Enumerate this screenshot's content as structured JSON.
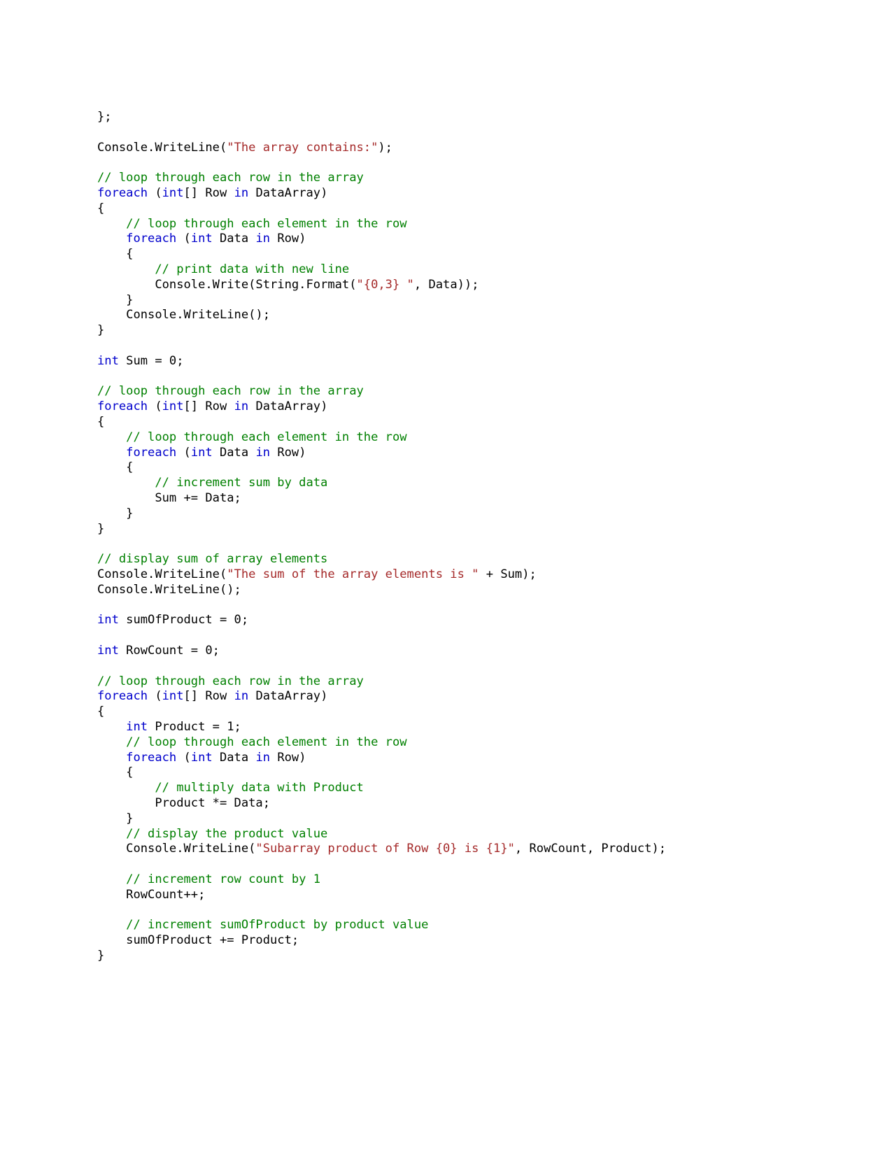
{
  "document": {
    "type": "code-listing",
    "language": "C#",
    "font": "monospace",
    "background_color": "#ffffff"
  },
  "colors": {
    "plain": "#000000",
    "keyword": "#0000CC",
    "comment": "#008000",
    "string": "#A52A2A",
    "background": "#ffffff"
  },
  "code": {
    "lines": [
      {
        "indent": 0,
        "tokens": [
          {
            "t": "};",
            "c": "plain"
          }
        ]
      },
      {
        "indent": 0,
        "tokens": []
      },
      {
        "indent": 0,
        "tokens": [
          {
            "t": "Console.WriteLine(",
            "c": "plain"
          },
          {
            "t": "\"The array contains:\"",
            "c": "string"
          },
          {
            "t": ");",
            "c": "plain"
          }
        ]
      },
      {
        "indent": 0,
        "tokens": []
      },
      {
        "indent": 0,
        "tokens": [
          {
            "t": "// loop through each row in the array",
            "c": "comment"
          }
        ]
      },
      {
        "indent": 0,
        "tokens": [
          {
            "t": "foreach",
            "c": "keyword"
          },
          {
            "t": " (",
            "c": "plain"
          },
          {
            "t": "int",
            "c": "keyword"
          },
          {
            "t": "[] Row ",
            "c": "plain"
          },
          {
            "t": "in",
            "c": "keyword"
          },
          {
            "t": " DataArray)",
            "c": "plain"
          }
        ]
      },
      {
        "indent": 0,
        "tokens": [
          {
            "t": "{",
            "c": "plain"
          }
        ]
      },
      {
        "indent": 1,
        "tokens": [
          {
            "t": "// loop through each element in the row",
            "c": "comment"
          }
        ]
      },
      {
        "indent": 1,
        "tokens": [
          {
            "t": "foreach",
            "c": "keyword"
          },
          {
            "t": " (",
            "c": "plain"
          },
          {
            "t": "int",
            "c": "keyword"
          },
          {
            "t": " Data ",
            "c": "plain"
          },
          {
            "t": "in",
            "c": "keyword"
          },
          {
            "t": " Row)",
            "c": "plain"
          }
        ]
      },
      {
        "indent": 1,
        "tokens": [
          {
            "t": "{",
            "c": "plain"
          }
        ]
      },
      {
        "indent": 2,
        "tokens": [
          {
            "t": "// print data with new line",
            "c": "comment"
          }
        ]
      },
      {
        "indent": 2,
        "tokens": [
          {
            "t": "Console.Write(String.Format(",
            "c": "plain"
          },
          {
            "t": "\"{0,3} \"",
            "c": "string"
          },
          {
            "t": ", Data));",
            "c": "plain"
          }
        ]
      },
      {
        "indent": 1,
        "tokens": [
          {
            "t": "}",
            "c": "plain"
          }
        ]
      },
      {
        "indent": 1,
        "tokens": [
          {
            "t": "Console.WriteLine();",
            "c": "plain"
          }
        ]
      },
      {
        "indent": 0,
        "tokens": [
          {
            "t": "}",
            "c": "plain"
          }
        ]
      },
      {
        "indent": 0,
        "tokens": []
      },
      {
        "indent": 0,
        "tokens": [
          {
            "t": "int",
            "c": "keyword"
          },
          {
            "t": " Sum = 0;",
            "c": "plain"
          }
        ]
      },
      {
        "indent": 0,
        "tokens": []
      },
      {
        "indent": 0,
        "tokens": [
          {
            "t": "// loop through each row in the array",
            "c": "comment"
          }
        ]
      },
      {
        "indent": 0,
        "tokens": [
          {
            "t": "foreach",
            "c": "keyword"
          },
          {
            "t": " (",
            "c": "plain"
          },
          {
            "t": "int",
            "c": "keyword"
          },
          {
            "t": "[] Row ",
            "c": "plain"
          },
          {
            "t": "in",
            "c": "keyword"
          },
          {
            "t": " DataArray)",
            "c": "plain"
          }
        ]
      },
      {
        "indent": 0,
        "tokens": [
          {
            "t": "{",
            "c": "plain"
          }
        ]
      },
      {
        "indent": 1,
        "tokens": [
          {
            "t": "// loop through each element in the row",
            "c": "comment"
          }
        ]
      },
      {
        "indent": 1,
        "tokens": [
          {
            "t": "foreach",
            "c": "keyword"
          },
          {
            "t": " (",
            "c": "plain"
          },
          {
            "t": "int",
            "c": "keyword"
          },
          {
            "t": " Data ",
            "c": "plain"
          },
          {
            "t": "in",
            "c": "keyword"
          },
          {
            "t": " Row)",
            "c": "plain"
          }
        ]
      },
      {
        "indent": 1,
        "tokens": [
          {
            "t": "{",
            "c": "plain"
          }
        ]
      },
      {
        "indent": 2,
        "tokens": [
          {
            "t": "// increment sum by data",
            "c": "comment"
          }
        ]
      },
      {
        "indent": 2,
        "tokens": [
          {
            "t": "Sum += Data;",
            "c": "plain"
          }
        ]
      },
      {
        "indent": 1,
        "tokens": [
          {
            "t": "}",
            "c": "plain"
          }
        ]
      },
      {
        "indent": 0,
        "tokens": [
          {
            "t": "}",
            "c": "plain"
          }
        ]
      },
      {
        "indent": 0,
        "tokens": []
      },
      {
        "indent": 0,
        "tokens": [
          {
            "t": "// display sum of array elements",
            "c": "comment"
          }
        ]
      },
      {
        "indent": 0,
        "tokens": [
          {
            "t": "Console.WriteLine(",
            "c": "plain"
          },
          {
            "t": "\"The sum of the array elements is \"",
            "c": "string"
          },
          {
            "t": " + Sum);",
            "c": "plain"
          }
        ]
      },
      {
        "indent": 0,
        "tokens": [
          {
            "t": "Console.WriteLine();",
            "c": "plain"
          }
        ]
      },
      {
        "indent": 0,
        "tokens": []
      },
      {
        "indent": 0,
        "tokens": [
          {
            "t": "int",
            "c": "keyword"
          },
          {
            "t": " sumOfProduct = 0;",
            "c": "plain"
          }
        ]
      },
      {
        "indent": 0,
        "tokens": []
      },
      {
        "indent": 0,
        "tokens": [
          {
            "t": "int",
            "c": "keyword"
          },
          {
            "t": " RowCount = 0;",
            "c": "plain"
          }
        ]
      },
      {
        "indent": 0,
        "tokens": []
      },
      {
        "indent": 0,
        "tokens": [
          {
            "t": "// loop through each row in the array",
            "c": "comment"
          }
        ]
      },
      {
        "indent": 0,
        "tokens": [
          {
            "t": "foreach",
            "c": "keyword"
          },
          {
            "t": " (",
            "c": "plain"
          },
          {
            "t": "int",
            "c": "keyword"
          },
          {
            "t": "[] Row ",
            "c": "plain"
          },
          {
            "t": "in",
            "c": "keyword"
          },
          {
            "t": " DataArray)",
            "c": "plain"
          }
        ]
      },
      {
        "indent": 0,
        "tokens": [
          {
            "t": "{",
            "c": "plain"
          }
        ]
      },
      {
        "indent": 1,
        "tokens": [
          {
            "t": "int",
            "c": "keyword"
          },
          {
            "t": " Product = 1;",
            "c": "plain"
          }
        ]
      },
      {
        "indent": 1,
        "tokens": [
          {
            "t": "// loop through each element in the row",
            "c": "comment"
          }
        ]
      },
      {
        "indent": 1,
        "tokens": [
          {
            "t": "foreach",
            "c": "keyword"
          },
          {
            "t": " (",
            "c": "plain"
          },
          {
            "t": "int",
            "c": "keyword"
          },
          {
            "t": " Data ",
            "c": "plain"
          },
          {
            "t": "in",
            "c": "keyword"
          },
          {
            "t": " Row)",
            "c": "plain"
          }
        ]
      },
      {
        "indent": 1,
        "tokens": [
          {
            "t": "{",
            "c": "plain"
          }
        ]
      },
      {
        "indent": 2,
        "tokens": [
          {
            "t": "// multiply data with Product",
            "c": "comment"
          }
        ]
      },
      {
        "indent": 2,
        "tokens": [
          {
            "t": "Product *= Data;",
            "c": "plain"
          }
        ]
      },
      {
        "indent": 1,
        "tokens": [
          {
            "t": "}",
            "c": "plain"
          }
        ]
      },
      {
        "indent": 1,
        "tokens": [
          {
            "t": "// display the product value",
            "c": "comment"
          }
        ]
      },
      {
        "indent": 1,
        "wrap": true,
        "tokens": [
          {
            "t": "Console.WriteLine(",
            "c": "plain"
          },
          {
            "t": "\"Subarray product of Row {0} is {1}\"",
            "c": "string"
          },
          {
            "t": ", RowCount, Product);",
            "c": "plain"
          }
        ]
      },
      {
        "indent": 0,
        "tokens": []
      },
      {
        "indent": 1,
        "tokens": [
          {
            "t": "// increment row count by 1",
            "c": "comment"
          }
        ]
      },
      {
        "indent": 1,
        "tokens": [
          {
            "t": "RowCount++;",
            "c": "plain"
          }
        ]
      },
      {
        "indent": 0,
        "tokens": []
      },
      {
        "indent": 1,
        "tokens": [
          {
            "t": "// increment sumOfProduct by product value",
            "c": "comment"
          }
        ]
      },
      {
        "indent": 1,
        "tokens": [
          {
            "t": "sumOfProduct += Product;",
            "c": "plain"
          }
        ]
      },
      {
        "indent": 0,
        "tokens": [
          {
            "t": "}",
            "c": "plain"
          }
        ]
      }
    ]
  }
}
